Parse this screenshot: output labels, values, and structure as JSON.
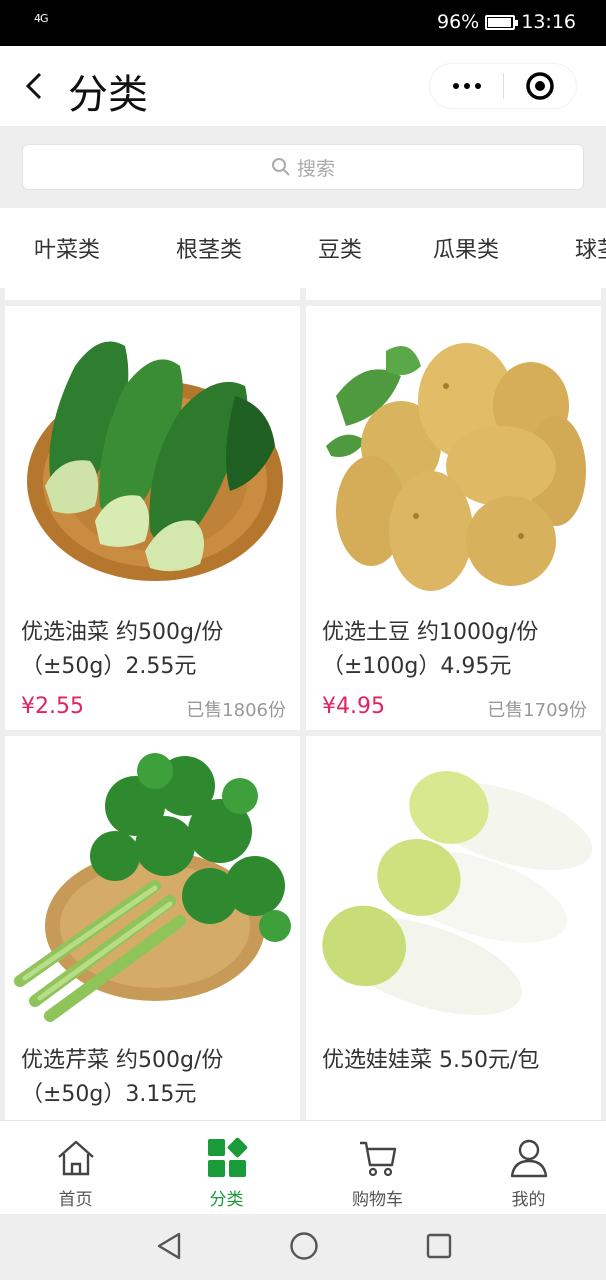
{
  "status": {
    "signal": "4G",
    "battery": "96%",
    "battery_level": 0.96,
    "time": "13:16"
  },
  "navbar": {
    "title": "分类",
    "back_icon": "chevron-left-icon",
    "more_icon": "more-dots-icon",
    "target_icon": "target-circle-icon"
  },
  "search": {
    "placeholder": "搜索",
    "icon": "search-icon"
  },
  "tabs": [
    {
      "label": "叶菜类"
    },
    {
      "label": "根茎类"
    },
    {
      "label": "豆类"
    },
    {
      "label": "瓜果类"
    },
    {
      "label": "球茎类"
    }
  ],
  "products": [
    {
      "name": "优选油菜 约500g/份（±50g）2.55元",
      "price": "¥2.55",
      "sold": "已售1806份",
      "image": "bok-choy-basket"
    },
    {
      "name": "优选土豆 约1000g/份（±100g）4.95元",
      "price": "¥4.95",
      "sold": "已售1709份",
      "image": "potatoes"
    },
    {
      "name": "优选芹菜 约500g/份（±50g）3.15元",
      "price": "",
      "sold": "",
      "image": "celery-basket"
    },
    {
      "name": "优选娃娃菜 5.50元/包",
      "price": "",
      "sold": "",
      "image": "baby-cabbage"
    }
  ],
  "tabbar": [
    {
      "label": "首页",
      "icon": "home-icon"
    },
    {
      "label": "分类",
      "icon": "category-grid-icon",
      "active": true
    },
    {
      "label": "购物车",
      "icon": "cart-icon"
    },
    {
      "label": "我的",
      "icon": "user-icon"
    }
  ],
  "colors": {
    "accent": "#1a9b3a",
    "price": "#e0245e"
  }
}
